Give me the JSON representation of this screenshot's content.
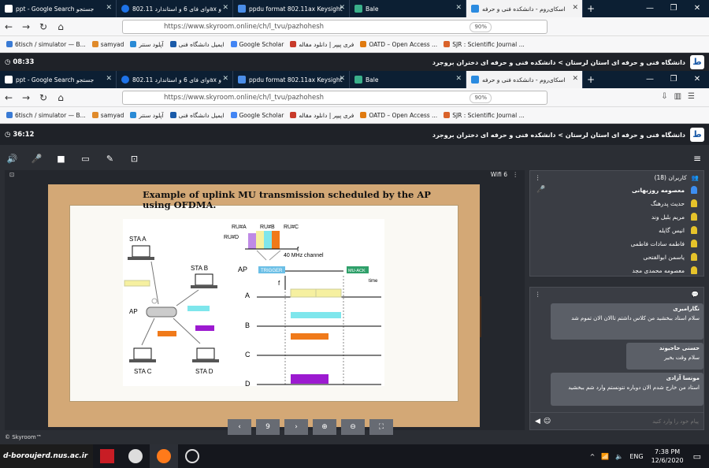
{
  "tabs": [
    {
      "label": "ppt - Google Search جستجو",
      "color": "#ffffff"
    },
    {
      "label": "وای فای 6 و استاندارد 802.11ax و",
      "color": "#1e73e8"
    },
    {
      "label": "ppdu format 802.11ax Keysight",
      "color": "#4b8ee8"
    },
    {
      "label": "Bale",
      "color": "#3ab08a"
    },
    {
      "label": "اسکای‌روم - دانشکده فنی و حرفه",
      "color": "#2b8be0"
    }
  ],
  "new_tab": "+",
  "win": {
    "min": "—",
    "max": "❐",
    "close": "✕"
  },
  "nav": {
    "back": "←",
    "forward": "→",
    "reload": "↻",
    "home": "⌂",
    "url": "https://www.skyroom.online/ch/l_tvu/pazhohesh",
    "zoom": "90%"
  },
  "bookmarks": [
    "6tisch / simulator — B...",
    "samyad",
    "آپلود سنتر",
    "ایمیل دانشگاه فنی",
    "Google Scholar",
    "فری پیپر | دانلود مقاله",
    "OATD – Open Access ...",
    "SJR : Scientific Journal ..."
  ],
  "session": {
    "timer_top": "08:33",
    "timer": "36:12",
    "title": "دانشگاه فنی و حرفه ای استان لرستان > دانشکده فنی و حرفه ای دختران بروجرد"
  },
  "stage": {
    "label": "Wifi 6",
    "page": "9"
  },
  "slide": {
    "title": "Example of uplink MU transmission scheduled by the AP using OFDMA.",
    "ru": [
      "RU#A",
      "RU#B",
      "RU#C",
      "RU#D"
    ],
    "f": "f",
    "channel": "40 MHz channel",
    "ap": "AP",
    "trigger": "TRIGGER",
    "muack": "MU-ACK",
    "time": "time",
    "rows": [
      "A",
      "B",
      "C",
      "D"
    ],
    "stations": [
      "STA A",
      "STA B",
      "STA C",
      "STA D"
    ],
    "ap_node": "AP",
    "colors": {
      "a": "#f6f0a0",
      "b": "#7ee6ec",
      "c": "#f07a1a",
      "d": "#9c1ad0",
      "trig": "#6bbfe6",
      "ack": "#2fa06a"
    }
  },
  "users": {
    "header": "کاربران (18)",
    "list": [
      "معصومه روزبهانی",
      "حدیث پدرهنگ",
      "مریم بلبل وند",
      "انیس گایله",
      "فاطمه سادات فاطمی",
      "یاسمن ابوالفتحی",
      "معصومه محمدی مجد"
    ]
  },
  "chat": {
    "messages": [
      {
        "name": "نگارامیری",
        "text": "سلام استاد ببخشید من کلاس داشتم تاالان الان تموم شد"
      },
      {
        "name": "حسنی حاجیوند",
        "text": "سلام وقت بخیر"
      },
      {
        "name": "مونسا آزادی",
        "text": "استاد من خارج شدم الان دوباره نتونستم وارد شم ببخشید"
      }
    ],
    "placeholder": "پیام خود را وارد کنید"
  },
  "footer": "© Skyroom™",
  "taskbar": {
    "brand": "d-boroujerd.nus.ac.ir",
    "lang": "ENG",
    "time": "7:38 PM",
    "date": "12/6/2020"
  }
}
